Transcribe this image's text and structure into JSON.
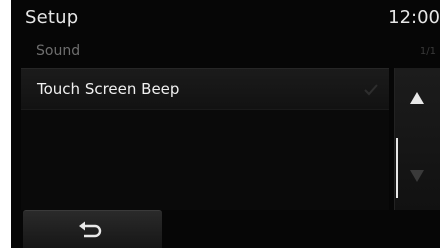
{
  "header": {
    "title": "Setup",
    "clock": "12:00"
  },
  "section": {
    "label": "Sound",
    "page_indicator": "1/1"
  },
  "list": {
    "items": [
      {
        "label": "Touch Screen Beep",
        "checked": false
      }
    ]
  },
  "icons": {
    "scroll_up": "triangle-up-icon",
    "scroll_down": "triangle-down-icon",
    "back": "return-arrow-icon",
    "check": "checkmark-icon"
  },
  "colors": {
    "background": "#060606",
    "text": "#e6e6e6",
    "muted": "#6e6e6e"
  }
}
